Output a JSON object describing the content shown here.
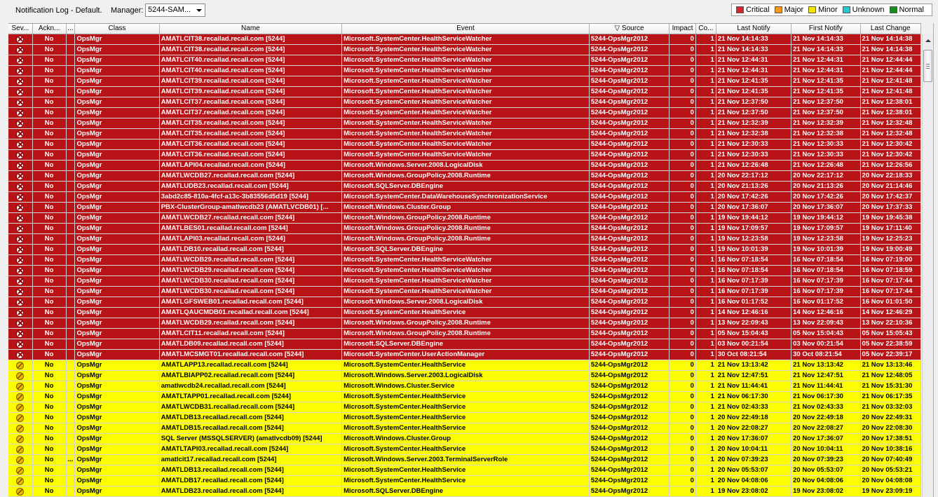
{
  "toolbar": {
    "title": "Notification Log - Default.",
    "manager_label": "Manager:",
    "manager_value": "5244-SAM..."
  },
  "legend": [
    {
      "label": "Critical",
      "color": "#d9232a"
    },
    {
      "label": "Major",
      "color": "#f59a1b"
    },
    {
      "label": "Minor",
      "color": "#f2e600"
    },
    {
      "label": "Unknown",
      "color": "#22c9cf"
    },
    {
      "label": "Normal",
      "color": "#1d8a1d"
    }
  ],
  "columns": [
    {
      "key": "severity",
      "label": "Sev..."
    },
    {
      "key": "ack",
      "label": "Ackn..."
    },
    {
      "key": "extra",
      "label": "..."
    },
    {
      "key": "class",
      "label": "Class"
    },
    {
      "key": "name",
      "label": "Name"
    },
    {
      "key": "event",
      "label": "Event"
    },
    {
      "key": "source",
      "label": "▽ Source"
    },
    {
      "key": "impact",
      "label": "Impact"
    },
    {
      "key": "count",
      "label": "Co..."
    },
    {
      "key": "last_notify",
      "label": "Last Notify"
    },
    {
      "key": "first_notify",
      "label": "First Notify"
    },
    {
      "key": "last_change",
      "label": "Last Change"
    }
  ],
  "rows": [
    {
      "severity": "critical",
      "ack": "No",
      "extra": "",
      "class": "OpsMgr",
      "name": "AMATLCIT38.recallad.recall.com [5244]",
      "event": "Microsoft.SystemCenter.HealthServiceWatcher",
      "source": "5244-OpsMgr2012",
      "impact": "0",
      "count": "1",
      "last_notify": "21 Nov 14:14:33",
      "first_notify": "21 Nov 14:14:33",
      "last_change": "21 Nov 14:14:38"
    },
    {
      "severity": "critical",
      "ack": "No",
      "extra": "",
      "class": "OpsMgr",
      "name": "AMATLCIT38.recallad.recall.com [5244]",
      "event": "Microsoft.SystemCenter.HealthServiceWatcher",
      "source": "5244-OpsMgr2012",
      "impact": "0",
      "count": "1",
      "last_notify": "21 Nov 14:14:33",
      "first_notify": "21 Nov 14:14:33",
      "last_change": "21 Nov 14:14:38"
    },
    {
      "severity": "critical",
      "ack": "No",
      "extra": "",
      "class": "OpsMgr",
      "name": "AMATLCIT40.recallad.recall.com [5244]",
      "event": "Microsoft.SystemCenter.HealthServiceWatcher",
      "source": "5244-OpsMgr2012",
      "impact": "0",
      "count": "1",
      "last_notify": "21 Nov 12:44:31",
      "first_notify": "21 Nov 12:44:31",
      "last_change": "21 Nov 12:44:44"
    },
    {
      "severity": "critical",
      "ack": "No",
      "extra": "",
      "class": "OpsMgr",
      "name": "AMATLCIT40.recallad.recall.com [5244]",
      "event": "Microsoft.SystemCenter.HealthServiceWatcher",
      "source": "5244-OpsMgr2012",
      "impact": "0",
      "count": "1",
      "last_notify": "21 Nov 12:44:31",
      "first_notify": "21 Nov 12:44:31",
      "last_change": "21 Nov 12:44:44"
    },
    {
      "severity": "critical",
      "ack": "No",
      "extra": "",
      "class": "OpsMgr",
      "name": "AMATLCIT39.recallad.recall.com [5244]",
      "event": "Microsoft.SystemCenter.HealthServiceWatcher",
      "source": "5244-OpsMgr2012",
      "impact": "0",
      "count": "1",
      "last_notify": "21 Nov 12:41:35",
      "first_notify": "21 Nov 12:41:35",
      "last_change": "21 Nov 12:41:48"
    },
    {
      "severity": "critical",
      "ack": "No",
      "extra": "",
      "class": "OpsMgr",
      "name": "AMATLCIT39.recallad.recall.com [5244]",
      "event": "Microsoft.SystemCenter.HealthServiceWatcher",
      "source": "5244-OpsMgr2012",
      "impact": "0",
      "count": "1",
      "last_notify": "21 Nov 12:41:35",
      "first_notify": "21 Nov 12:41:35",
      "last_change": "21 Nov 12:41:48"
    },
    {
      "severity": "critical",
      "ack": "No",
      "extra": "",
      "class": "OpsMgr",
      "name": "AMATLCIT37.recallad.recall.com [5244]",
      "event": "Microsoft.SystemCenter.HealthServiceWatcher",
      "source": "5244-OpsMgr2012",
      "impact": "0",
      "count": "1",
      "last_notify": "21 Nov 12:37:50",
      "first_notify": "21 Nov 12:37:50",
      "last_change": "21 Nov 12:38:01"
    },
    {
      "severity": "critical",
      "ack": "No",
      "extra": "",
      "class": "OpsMgr",
      "name": "AMATLCIT37.recallad.recall.com [5244]",
      "event": "Microsoft.SystemCenter.HealthServiceWatcher",
      "source": "5244-OpsMgr2012",
      "impact": "0",
      "count": "1",
      "last_notify": "21 Nov 12:37:50",
      "first_notify": "21 Nov 12:37:50",
      "last_change": "21 Nov 12:38:01"
    },
    {
      "severity": "critical",
      "ack": "No",
      "extra": "",
      "class": "OpsMgr",
      "name": "AMATLCIT35.recallad.recall.com [5244]",
      "event": "Microsoft.SystemCenter.HealthServiceWatcher",
      "source": "5244-OpsMgr2012",
      "impact": "0",
      "count": "1",
      "last_notify": "21 Nov 12:32:39",
      "first_notify": "21 Nov 12:32:39",
      "last_change": "21 Nov 12:32:48"
    },
    {
      "severity": "critical",
      "ack": "No",
      "extra": "",
      "class": "OpsMgr",
      "name": "AMATLCIT35.recallad.recall.com [5244]",
      "event": "Microsoft.SystemCenter.HealthServiceWatcher",
      "source": "5244-OpsMgr2012",
      "impact": "0",
      "count": "1",
      "last_notify": "21 Nov 12:32:38",
      "first_notify": "21 Nov 12:32:38",
      "last_change": "21 Nov 12:32:48"
    },
    {
      "severity": "critical",
      "ack": "No",
      "extra": "",
      "class": "OpsMgr",
      "name": "AMATLCIT36.recallad.recall.com [5244]",
      "event": "Microsoft.SystemCenter.HealthServiceWatcher",
      "source": "5244-OpsMgr2012",
      "impact": "0",
      "count": "1",
      "last_notify": "21 Nov 12:30:33",
      "first_notify": "21 Nov 12:30:33",
      "last_change": "21 Nov 12:30:42"
    },
    {
      "severity": "critical",
      "ack": "No",
      "extra": "",
      "class": "OpsMgr",
      "name": "AMATLCIT36.recallad.recall.com [5244]",
      "event": "Microsoft.SystemCenter.HealthServiceWatcher",
      "source": "5244-OpsMgr2012",
      "impact": "0",
      "count": "1",
      "last_notify": "21 Nov 12:30:33",
      "first_notify": "21 Nov 12:30:33",
      "last_change": "21 Nov 12:30:42"
    },
    {
      "severity": "critical",
      "ack": "No",
      "extra": "",
      "class": "OpsMgr",
      "name": "AMATLAPI04.recallad.recall.com [5244]",
      "event": "Microsoft.Windows.Server.2008.LogicalDisk",
      "source": "5244-OpsMgr2012",
      "impact": "0",
      "count": "1",
      "last_notify": "21 Nov 12:26:48",
      "first_notify": "21 Nov 12:26:48",
      "last_change": "21 Nov 12:26:56"
    },
    {
      "severity": "critical",
      "ack": "No",
      "extra": "",
      "class": "OpsMgr",
      "name": "AMATLWCDB27.recallad.recall.com [5244]",
      "event": "Microsoft.Windows.GroupPolicy.2008.Runtime",
      "source": "5244-OpsMgr2012",
      "impact": "0",
      "count": "1",
      "last_notify": "20 Nov 22:17:12",
      "first_notify": "20 Nov 22:17:12",
      "last_change": "20 Nov 22:18:33"
    },
    {
      "severity": "critical",
      "ack": "No",
      "extra": "",
      "class": "OpsMgr",
      "name": "AMATLUDB23.recallad.recall.com [5244]",
      "event": "Microsoft.SQLServer.DBEngine",
      "source": "5244-OpsMgr2012",
      "impact": "0",
      "count": "1",
      "last_notify": "20 Nov 21:13:26",
      "first_notify": "20 Nov 21:13:26",
      "last_change": "20 Nov 21:14:46"
    },
    {
      "severity": "critical",
      "ack": "No",
      "extra": "",
      "class": "OpsMgr",
      "name": "3abd2c85-810a-4fcf-a13c-3b83556d5d19 [5244]",
      "event": "Microsoft.SystemCenter.DataWarehouseSynchronizationService",
      "source": "5244-OpsMgr2012",
      "impact": "0",
      "count": "1",
      "last_notify": "20 Nov 17:42:26",
      "first_notify": "20 Nov 17:42:26",
      "last_change": "20 Nov 17:42:37"
    },
    {
      "severity": "critical",
      "ack": "No",
      "extra": "",
      "class": "OpsMgr",
      "name": "PBX-ClusterGroup-amatlwcdb23 (AMATLVCDB01) [...",
      "event": "Microsoft.Windows.Cluster.Group",
      "source": "5244-OpsMgr2012",
      "impact": "0",
      "count": "1",
      "last_notify": "20 Nov 17:36:07",
      "first_notify": "20 Nov 17:36:07",
      "last_change": "20 Nov 17:37:33"
    },
    {
      "severity": "critical",
      "ack": "No",
      "extra": "",
      "class": "OpsMgr",
      "name": "AMATLWCDB27.recallad.recall.com [5244]",
      "event": "Microsoft.Windows.GroupPolicy.2008.Runtime",
      "source": "5244-OpsMgr2012",
      "impact": "0",
      "count": "1",
      "last_notify": "19 Nov 19:44:12",
      "first_notify": "19 Nov 19:44:12",
      "last_change": "19 Nov 19:45:38"
    },
    {
      "severity": "critical",
      "ack": "No",
      "extra": "",
      "class": "OpsMgr",
      "name": "AMATLBES01.recallad.recall.com [5244]",
      "event": "Microsoft.Windows.GroupPolicy.2008.Runtime",
      "source": "5244-OpsMgr2012",
      "impact": "0",
      "count": "1",
      "last_notify": "19 Nov 17:09:57",
      "first_notify": "19 Nov 17:09:57",
      "last_change": "19 Nov 17:11:40"
    },
    {
      "severity": "critical",
      "ack": "No",
      "extra": "",
      "class": "OpsMgr",
      "name": "AMATLAPI03.recallad.recall.com [5244]",
      "event": "Microsoft.Windows.GroupPolicy.2008.Runtime",
      "source": "5244-OpsMgr2012",
      "impact": "0",
      "count": "1",
      "last_notify": "19 Nov 12:23:58",
      "first_notify": "19 Nov 12:23:58",
      "last_change": "19 Nov 12:25:23"
    },
    {
      "severity": "critical",
      "ack": "No",
      "extra": "",
      "class": "OpsMgr",
      "name": "AMATLDB10.recallad.recall.com [5244]",
      "event": "Microsoft.SQLServer.DBEngine",
      "source": "5244-OpsMgr2012",
      "impact": "0",
      "count": "1",
      "last_notify": "19 Nov 10:01:39",
      "first_notify": "19 Nov 10:01:39",
      "last_change": "19 Nov 19:00:49"
    },
    {
      "severity": "critical",
      "ack": "No",
      "extra": "",
      "class": "OpsMgr",
      "name": "AMATLWCDB29.recallad.recall.com [5244]",
      "event": "Microsoft.SystemCenter.HealthServiceWatcher",
      "source": "5244-OpsMgr2012",
      "impact": "0",
      "count": "1",
      "last_notify": "16 Nov 07:18:54",
      "first_notify": "16 Nov 07:18:54",
      "last_change": "16 Nov 07:19:00"
    },
    {
      "severity": "critical",
      "ack": "No",
      "extra": "",
      "class": "OpsMgr",
      "name": "AMATLWCDB29.recallad.recall.com [5244]",
      "event": "Microsoft.SystemCenter.HealthServiceWatcher",
      "source": "5244-OpsMgr2012",
      "impact": "0",
      "count": "1",
      "last_notify": "16 Nov 07:18:54",
      "first_notify": "16 Nov 07:18:54",
      "last_change": "16 Nov 07:18:59"
    },
    {
      "severity": "critical",
      "ack": "No",
      "extra": "",
      "class": "OpsMgr",
      "name": "AMATLWCDB30.recallad.recall.com [5244]",
      "event": "Microsoft.SystemCenter.HealthServiceWatcher",
      "source": "5244-OpsMgr2012",
      "impact": "0",
      "count": "1",
      "last_notify": "16 Nov 07:17:39",
      "first_notify": "16 Nov 07:17:39",
      "last_change": "16 Nov 07:17:44"
    },
    {
      "severity": "critical",
      "ack": "No",
      "extra": "",
      "class": "OpsMgr",
      "name": "AMATLWCDB30.recallad.recall.com [5244]",
      "event": "Microsoft.SystemCenter.HealthServiceWatcher",
      "source": "5244-OpsMgr2012",
      "impact": "0",
      "count": "1",
      "last_notify": "16 Nov 07:17:39",
      "first_notify": "16 Nov 07:17:39",
      "last_change": "16 Nov 07:17:44"
    },
    {
      "severity": "critical",
      "ack": "No",
      "extra": "",
      "class": "OpsMgr",
      "name": "AMATLGFSWEB01.recallad.recall.com [5244]",
      "event": "Microsoft.Windows.Server.2008.LogicalDisk",
      "source": "5244-OpsMgr2012",
      "impact": "0",
      "count": "1",
      "last_notify": "16 Nov 01:17:52",
      "first_notify": "16 Nov 01:17:52",
      "last_change": "16 Nov 01:01:50"
    },
    {
      "severity": "critical",
      "ack": "No",
      "extra": "",
      "class": "OpsMgr",
      "name": "AMATLQAUCMDB01.recallad.recall.com [5244]",
      "event": "Microsoft.SystemCenter.HealthService",
      "source": "5244-OpsMgr2012",
      "impact": "0",
      "count": "1",
      "last_notify": "14 Nov 12:46:16",
      "first_notify": "14 Nov 12:46:16",
      "last_change": "14 Nov 12:46:29"
    },
    {
      "severity": "critical",
      "ack": "No",
      "extra": "",
      "class": "OpsMgr",
      "name": "AMATLWCDB29.recallad.recall.com [5244]",
      "event": "Microsoft.Windows.GroupPolicy.2008.Runtime",
      "source": "5244-OpsMgr2012",
      "impact": "0",
      "count": "1",
      "last_notify": "13 Nov 22:09:43",
      "first_notify": "13 Nov 22:09:43",
      "last_change": "13 Nov 22:10:36"
    },
    {
      "severity": "critical",
      "ack": "No",
      "extra": "",
      "class": "OpsMgr",
      "name": "AMATLCIT11.recallad.recall.com [5244]",
      "event": "Microsoft.Windows.GroupPolicy.2008.Runtime",
      "source": "5244-OpsMgr2012",
      "impact": "0",
      "count": "1",
      "last_notify": "05 Nov 15:04:43",
      "first_notify": "05 Nov 15:04:43",
      "last_change": "05 Nov 15:05:43"
    },
    {
      "severity": "critical",
      "ack": "No",
      "extra": "",
      "class": "OpsMgr",
      "name": "AMATLDB09.recallad.recall.com [5244]",
      "event": "Microsoft.SQLServer.DBEngine",
      "source": "5244-OpsMgr2012",
      "impact": "0",
      "count": "1",
      "last_notify": "03 Nov 00:21:54",
      "first_notify": "03 Nov 00:21:54",
      "last_change": "05 Nov 22:38:59"
    },
    {
      "severity": "critical",
      "ack": "No",
      "extra": "",
      "class": "OpsMgr",
      "name": "AMATLMCSMGT01.recallad.recall.com [5244]",
      "event": "Microsoft.SystemCenter.UserActionManager",
      "source": "5244-OpsMgr2012",
      "impact": "0",
      "count": "1",
      "last_notify": "30 Oct 08:21:54",
      "first_notify": "30 Oct 08:21:54",
      "last_change": "05 Nov 22:39:17"
    },
    {
      "severity": "minor",
      "ack": "No",
      "extra": "",
      "class": "OpsMgr",
      "name": "AMATLAPP13.recallad.recall.com [5244]",
      "event": "Microsoft.SystemCenter.HealthService",
      "source": "5244-OpsMgr2012",
      "impact": "0",
      "count": "1",
      "last_notify": "21 Nov 13:13:42",
      "first_notify": "21 Nov 13:13:42",
      "last_change": "21 Nov 13:13:46"
    },
    {
      "severity": "minor",
      "ack": "No",
      "extra": "",
      "class": "OpsMgr",
      "name": "AMATLBIAPP02.recallad.recall.com [5244]",
      "event": "Microsoft.Windows.Server.2003.LogicalDisk",
      "source": "5244-OpsMgr2012",
      "impact": "0",
      "count": "1",
      "last_notify": "21 Nov 12:47:51",
      "first_notify": "21 Nov 12:47:51",
      "last_change": "21 Nov 12:48:05"
    },
    {
      "severity": "minor",
      "ack": "No",
      "extra": "",
      "class": "OpsMgr",
      "name": "amatlwcdb24.recallad.recall.com [5244]",
      "event": "Microsoft.Windows.Cluster.Service",
      "source": "5244-OpsMgr2012",
      "impact": "0",
      "count": "1",
      "last_notify": "21 Nov 11:44:41",
      "first_notify": "21 Nov 11:44:41",
      "last_change": "21 Nov 15:31:30"
    },
    {
      "severity": "minor",
      "ack": "No",
      "extra": "",
      "class": "OpsMgr",
      "name": "AMATLTAPP01.recallad.recall.com [5244]",
      "event": "Microsoft.SystemCenter.HealthService",
      "source": "5244-OpsMgr2012",
      "impact": "0",
      "count": "1",
      "last_notify": "21 Nov 06:17:30",
      "first_notify": "21 Nov 06:17:30",
      "last_change": "21 Nov 06:17:35"
    },
    {
      "severity": "minor",
      "ack": "No",
      "extra": "",
      "class": "OpsMgr",
      "name": "AMATLWCDB31.recallad.recall.com [5244]",
      "event": "Microsoft.SystemCenter.HealthService",
      "source": "5244-OpsMgr2012",
      "impact": "0",
      "count": "1",
      "last_notify": "21 Nov 02:43:33",
      "first_notify": "21 Nov 02:43:33",
      "last_change": "21 Nov 03:32:03"
    },
    {
      "severity": "minor",
      "ack": "No",
      "extra": "",
      "class": "OpsMgr",
      "name": "AMATLDB13.recallad.recall.com [5244]",
      "event": "Microsoft.SystemCenter.HealthService",
      "source": "5244-OpsMgr2012",
      "impact": "0",
      "count": "1",
      "last_notify": "20 Nov 22:49:18",
      "first_notify": "20 Nov 22:49:18",
      "last_change": "20 Nov 22:49:31"
    },
    {
      "severity": "minor",
      "ack": "No",
      "extra": "",
      "class": "OpsMgr",
      "name": "AMATLDB15.recallad.recall.com [5244]",
      "event": "Microsoft.SystemCenter.HealthService",
      "source": "5244-OpsMgr2012",
      "impact": "0",
      "count": "1",
      "last_notify": "20 Nov 22:08:27",
      "first_notify": "20 Nov 22:08:27",
      "last_change": "20 Nov 22:08:30"
    },
    {
      "severity": "minor",
      "ack": "No",
      "extra": "",
      "class": "OpsMgr",
      "name": "SQL Server (MSSQLSERVER) (amatlvcdb09) [5244]",
      "event": "Microsoft.Windows.Cluster.Group",
      "source": "5244-OpsMgr2012",
      "impact": "0",
      "count": "1",
      "last_notify": "20 Nov 17:36:07",
      "first_notify": "20 Nov 17:36:07",
      "last_change": "20 Nov 17:38:51"
    },
    {
      "severity": "minor",
      "ack": "No",
      "extra": "",
      "class": "OpsMgr",
      "name": "AMATLTAPI03.recallad.recall.com [5244]",
      "event": "Microsoft.SystemCenter.HealthService",
      "source": "5244-OpsMgr2012",
      "impact": "0",
      "count": "1",
      "last_notify": "20 Nov 10:04:11",
      "first_notify": "20 Nov 10:04:11",
      "last_change": "20 Nov 10:38:16"
    },
    {
      "severity": "minor",
      "ack": "No",
      "extra": "...",
      "class": "OpsMgr",
      "name": "amatlcit17.recallad.recall.com [5244]",
      "event": "Microsoft.Windows.Server.2003.TerminalServerRole",
      "source": "5244-OpsMgr2012",
      "impact": "0",
      "count": "1",
      "last_notify": "20 Nov 07:39:23",
      "first_notify": "20 Nov 07:39:23",
      "last_change": "20 Nov 07:40:49"
    },
    {
      "severity": "minor",
      "ack": "No",
      "extra": "",
      "class": "OpsMgr",
      "name": "AMATLDB13.recallad.recall.com [5244]",
      "event": "Microsoft.SystemCenter.HealthService",
      "source": "5244-OpsMgr2012",
      "impact": "0",
      "count": "1",
      "last_notify": "20 Nov 05:53:07",
      "first_notify": "20 Nov 05:53:07",
      "last_change": "20 Nov 05:53:21"
    },
    {
      "severity": "minor",
      "ack": "No",
      "extra": "",
      "class": "OpsMgr",
      "name": "AMATLDB17.recallad.recall.com [5244]",
      "event": "Microsoft.SystemCenter.HealthService",
      "source": "5244-OpsMgr2012",
      "impact": "0",
      "count": "1",
      "last_notify": "20 Nov 04:08:06",
      "first_notify": "20 Nov 04:08:06",
      "last_change": "20 Nov 04:08:08"
    },
    {
      "severity": "minor",
      "ack": "No",
      "extra": "",
      "class": "OpsMgr",
      "name": "AMATLDB23.recallad.recall.com [5244]",
      "event": "Microsoft.SQLServer.DBEngine",
      "source": "5244-OpsMgr2012",
      "impact": "0",
      "count": "1",
      "last_notify": "19 Nov 23:08:02",
      "first_notify": "19 Nov 23:08:02",
      "last_change": "19 Nov 23:09:19"
    }
  ]
}
